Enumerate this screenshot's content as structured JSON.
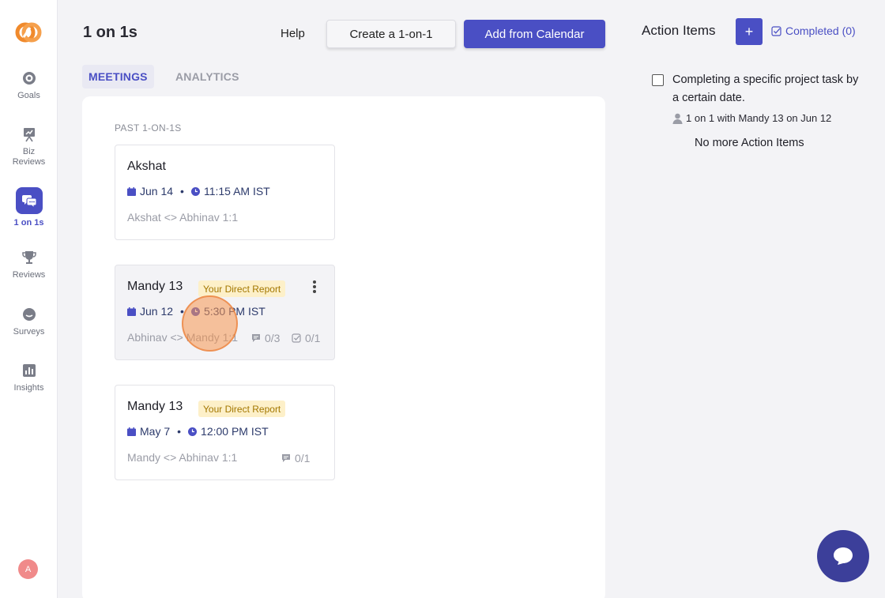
{
  "sidebar": {
    "items": [
      {
        "label": "Goals",
        "icon": "target-icon"
      },
      {
        "label": "Biz\nReviews",
        "icon": "presentation-icon"
      },
      {
        "label": "1 on 1s",
        "icon": "chat-bubbles-icon"
      },
      {
        "label": "Reviews",
        "icon": "trophy-icon"
      },
      {
        "label": "Surveys",
        "icon": "survey-icon"
      },
      {
        "label": "Insights",
        "icon": "bar-chart-icon"
      }
    ],
    "avatar_initial": "A"
  },
  "header": {
    "title": "1 on 1s",
    "help_label": "Help",
    "create_label": "Create a 1-on-1",
    "calendar_label": "Add from Calendar"
  },
  "tabs": [
    {
      "label": "MEETINGS",
      "active": true
    },
    {
      "label": "ANALYTICS",
      "active": false
    }
  ],
  "meetings": {
    "section_label": "PAST 1-ON-1S",
    "cards": [
      {
        "name": "Akshat",
        "badge": "",
        "date": "Jun 14",
        "time": "11:15 AM IST",
        "description": "Akshat <> Abhinav 1:1",
        "comments": "",
        "tasks": ""
      },
      {
        "name": "Mandy 13",
        "badge": "Your Direct Report",
        "date": "Jun 12",
        "time": "5:30 PM IST",
        "description": "Abhinav <> Mandy 1:1",
        "comments": "0/3",
        "tasks": "0/1"
      },
      {
        "name": "Mandy 13",
        "badge": "Your Direct Report",
        "date": "May 7",
        "time": "12:00 PM IST",
        "description": "Mandy <> Abhinav 1:1",
        "comments": "0/1",
        "tasks": ""
      }
    ]
  },
  "action_items": {
    "title": "Action Items",
    "add_label": "+",
    "completed_label": "Completed (0)",
    "items": [
      {
        "text": "Completing a specific project task by a certain date.",
        "meta": "1 on 1 with Mandy 13 on Jun 12"
      }
    ],
    "empty_label": "No more Action Items"
  },
  "colors": {
    "accent": "#4a4fc4",
    "badge_bg": "#fdf0c9",
    "badge_text": "#a37700",
    "chat_button": "#3c3f9a"
  }
}
